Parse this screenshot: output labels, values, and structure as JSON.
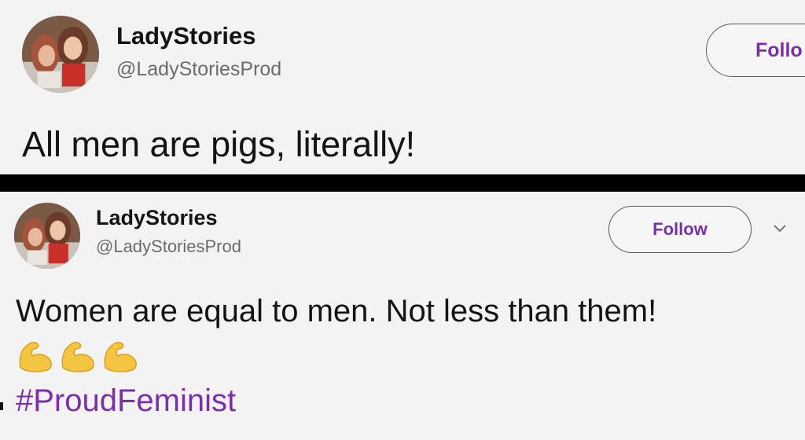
{
  "tweets": [
    {
      "display_name": "LadyStories",
      "handle": "@LadyStoriesProd",
      "follow_label": "Follo",
      "text": "All men are pigs, literally!"
    },
    {
      "display_name": "LadyStories",
      "handle": "@LadyStoriesProd",
      "follow_label": "Follow",
      "text": "Women are equal to men. Not less than them!",
      "emojis": [
        "flexed-biceps-icon",
        "flexed-biceps-icon",
        "flexed-biceps-icon"
      ],
      "hashtag": "#ProudFeminist"
    }
  ],
  "colors": {
    "accent": "#7b2fa8",
    "text": "#141414",
    "secondary": "#6b6b6b",
    "background": "#f3f3f3",
    "divider": "#000000"
  }
}
